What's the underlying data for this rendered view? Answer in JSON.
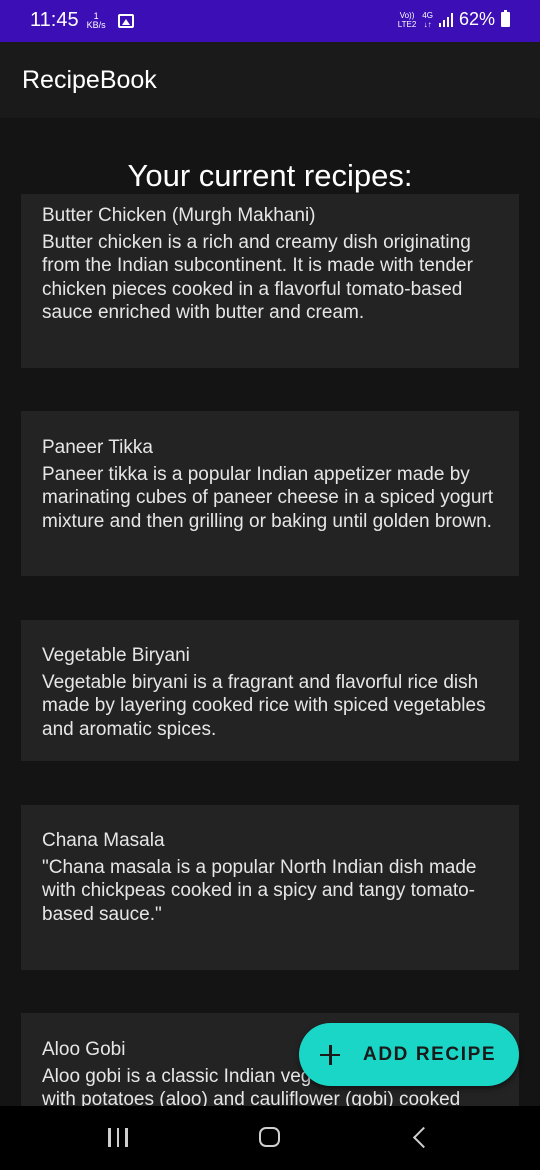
{
  "status_bar": {
    "time": "11:45",
    "net_speed_value": "1",
    "net_speed_unit": "KB/s",
    "volte_top": "Vo))",
    "volte_bottom": "LTE2",
    "network": "4G",
    "network_arrows": "↓↑",
    "battery": "62%",
    "background_color": "#3c0fb6"
  },
  "app_bar": {
    "title": "RecipeBook"
  },
  "main": {
    "heading": "Your current recipes:",
    "recipes": [
      {
        "title": "Butter Chicken (Murgh Makhani)",
        "description": "Butter chicken is a rich and creamy dish originating from the Indian subcontinent. It is made with tender chicken pieces cooked in a flavorful tomato-based sauce enriched with butter and cream."
      },
      {
        "title": "Paneer Tikka",
        "description": "Paneer tikka is a popular Indian appetizer made by marinating cubes of paneer cheese in a spiced yogurt mixture and then grilling or baking until golden brown."
      },
      {
        "title": "Vegetable Biryani",
        "description": "Vegetable biryani is a fragrant and flavorful rice dish made by layering cooked rice with spiced vegetables and aromatic spices."
      },
      {
        "title": "Chana Masala",
        "description": "\"Chana masala is a popular North Indian dish made with chickpeas cooked in a spicy and tangy tomato-based sauce.\""
      },
      {
        "title": "Aloo Gobi",
        "description": "Aloo gobi is a classic Indian vegetarian dish made with potatoes (aloo) and cauliflower (gobi) cooked"
      }
    ]
  },
  "fab": {
    "label": "ADD RECIPE",
    "icon": "plus-icon",
    "color": "#19d6c6"
  },
  "nav_bar": {
    "icons": [
      "recents-icon",
      "home-icon",
      "back-icon"
    ]
  }
}
